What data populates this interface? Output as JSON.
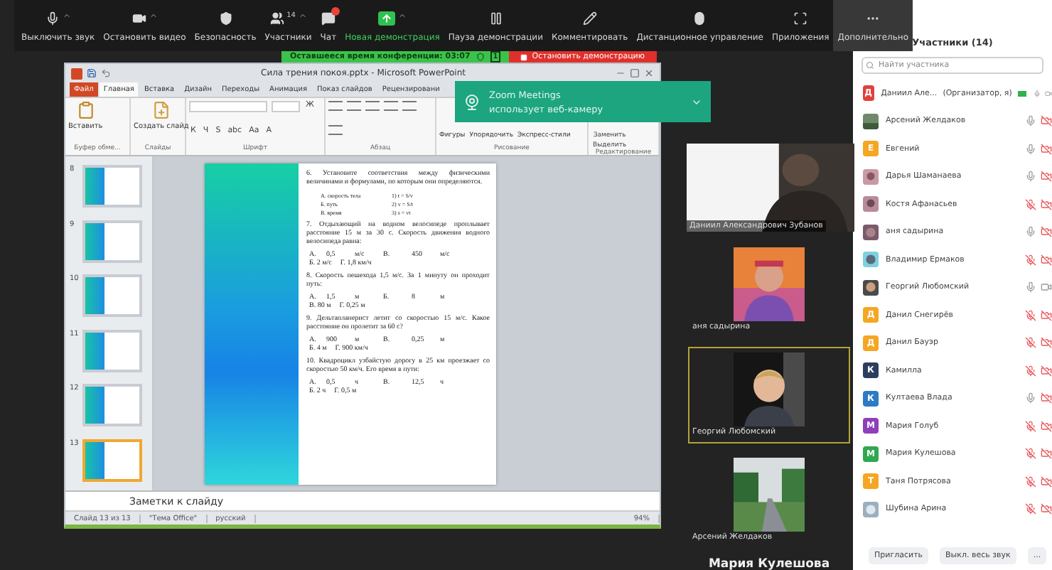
{
  "toolbar": {
    "items": [
      {
        "kind": "mic",
        "label": "Выключить звук",
        "caret": true
      },
      {
        "kind": "video",
        "label": "Остановить видео",
        "caret": true
      },
      {
        "kind": "security",
        "label": "Безопасность",
        "caret": false
      },
      {
        "kind": "participants",
        "label": "Участники",
        "caret": true,
        "count": "14"
      },
      {
        "kind": "chat",
        "label": "Чат",
        "caret": false
      },
      {
        "kind": "share",
        "label": "Новая демонстрация",
        "caret": true
      },
      {
        "kind": "pause",
        "label": "Пауза демонстрации",
        "caret": false
      },
      {
        "kind": "annotate",
        "label": "Комментировать",
        "caret": false
      },
      {
        "kind": "remote",
        "label": "Дистанционное управление",
        "caret": false
      },
      {
        "kind": "apps",
        "label": "Приложения",
        "caret": false
      },
      {
        "kind": "more",
        "label": "Дополнительно",
        "caret": false
      }
    ]
  },
  "meeting_bar": {
    "timer": "Оставшееся время конференции: 03:07",
    "counter": "1",
    "stop": "Остановить демонстрацию"
  },
  "powerpoint": {
    "title": "Сила трения покоя.pptx - Microsoft PowerPoint",
    "tabs": [
      {
        "label": "Файл",
        "selected": false,
        "kind": "file"
      },
      {
        "label": "Главная",
        "selected": true,
        "kind": "tab"
      },
      {
        "label": "Вставка",
        "selected": false,
        "kind": "tab"
      },
      {
        "label": "Дизайн",
        "selected": false,
        "kind": "tab"
      },
      {
        "label": "Переходы",
        "selected": false,
        "kind": "tab"
      },
      {
        "label": "Анимация",
        "selected": false,
        "kind": "tab"
      },
      {
        "label": "Показ слайдов",
        "selected": false,
        "kind": "tab"
      },
      {
        "label": "Рецензировани",
        "selected": false,
        "kind": "tab"
      }
    ],
    "ribbon": [
      {
        "kind": "clipboard",
        "label": "Буфер обме...",
        "buttons": [
          "Вставить"
        ]
      },
      {
        "kind": "slides",
        "label": "Слайды",
        "buttons": [
          "Создать слайд"
        ]
      },
      {
        "kind": "font",
        "label": "Шрифт",
        "buttons": [
          "Ж",
          "К",
          "Ч",
          "S",
          "abc",
          "Aa",
          "A"
        ]
      },
      {
        "kind": "paragraph",
        "label": "Абзац"
      },
      {
        "kind": "drawing",
        "label": "Рисование",
        "buttons": [
          "Фигуры",
          "Упорядочить",
          "Экспресс-стили"
        ]
      },
      {
        "kind": "editing",
        "label": "Редактирование",
        "buttons": [
          "Заменить",
          "Выделить"
        ]
      }
    ],
    "thumbnails": [
      {
        "number": "8",
        "selected": false
      },
      {
        "number": "9",
        "selected": false
      },
      {
        "number": "10",
        "selected": false
      },
      {
        "number": "11",
        "selected": false
      },
      {
        "number": "12",
        "selected": false
      },
      {
        "number": "13",
        "selected": true
      }
    ],
    "slide": [
      {
        "kind": "question",
        "text": "6. Установите соответствия между физическими величинами и формулами, по которым они определяются."
      },
      {
        "kind": "matching",
        "rows": [
          [
            "А. скорость тела",
            "1) t = S/v"
          ],
          [
            "Б. путь",
            "2) v = S/t"
          ],
          [
            "В. время",
            "3) s = vt"
          ]
        ]
      },
      {
        "kind": "question",
        "text": "7. Отдыхающий на водном велосипеде проплывает расстояние 15 м за 30 с. Скорость движения водного велосипеда равна:"
      },
      {
        "kind": "answers",
        "grid": [
          "А.",
          "0,5",
          "м/с",
          "В.",
          "450",
          "м/с"
        ],
        "line": [
          "Б. 2 м/с",
          "Г. 1,8 км/ч"
        ]
      },
      {
        "kind": "question",
        "text": "8. Скорость пешехода 1,5 м/с. За 1 минуту он проходит путь:"
      },
      {
        "kind": "answers",
        "grid": [
          "А.",
          "1,5",
          "м",
          "Б.",
          "8",
          "м"
        ],
        "line": [
          "В. 80 м",
          "Г. 0,25 м"
        ]
      },
      {
        "kind": "question",
        "text": "9. Дельтапланерист летит со скоростью 15 м/с. Какое расстояние он пролетит за 60 с?"
      },
      {
        "kind": "answers",
        "grid": [
          "А.",
          "900",
          "м",
          "В.",
          "0,25",
          "м"
        ],
        "line": [
          "Б. 4 м",
          "Г. 900 км/ч"
        ]
      },
      {
        "kind": "question",
        "text": "10. Квадроцикл узбайстую дорогу в 25 км проезжает со скоростью 50 км/ч. Его время в пути:"
      },
      {
        "kind": "answers",
        "grid": [
          "А.",
          "0,5",
          "ч",
          "В.",
          "12,5",
          "ч"
        ],
        "line": [
          "Б. 2 ч",
          "Г. 0,5 м"
        ]
      }
    ],
    "notes": "Заметки к слайду",
    "status": {
      "slide": "Слайд 13 из 13",
      "theme": "\"Тема Office\"",
      "language": "русский",
      "zoom": "94%"
    }
  },
  "notification": {
    "title": "Zoom Meetings",
    "text": "использует веб-камеру"
  },
  "videos": [
    {
      "name": "Даниил Александрович Зубанов",
      "highlighted": false
    },
    {
      "name": "аня садырина",
      "highlighted": false
    },
    {
      "name": "Георгий Любомский",
      "highlighted": true
    },
    {
      "name": "Арсений Желдаков",
      "highlighted": false
    }
  ],
  "active_speaker": "Мария Кулешова",
  "participants": {
    "title": "Участники (14)",
    "search_placeholder": "Найти участника",
    "rows": [
      {
        "name": "Даниил Але...",
        "role": "(Организатор, я)",
        "avatar": {
          "kind": "letter",
          "letter": "Д",
          "color": "#e0413b"
        },
        "mic_muted": false,
        "video_off": false
      },
      {
        "name": "Арсений Желдаков",
        "mic_muted": false,
        "video_off": true
      },
      {
        "name": "Евгений",
        "avatar": {
          "kind": "letter",
          "letter": "Е",
          "color": "#f5a623"
        },
        "mic_muted": false,
        "video_off": true
      },
      {
        "name": "Дарья Шаманаева",
        "mic_muted": false,
        "video_off": true
      },
      {
        "name": "Костя Афанасьев",
        "mic_muted": true,
        "video_off": true
      },
      {
        "name": "аня садырина",
        "mic_muted": false,
        "video_off": true
      },
      {
        "name": "Владимир Ермаков",
        "mic_muted": true,
        "video_off": true
      },
      {
        "name": "Георгий Любомский",
        "mic_muted": false,
        "video_off": false
      },
      {
        "name": "Данил Снегирёв",
        "avatar": {
          "kind": "letter",
          "letter": "Д",
          "color": "#f5a623"
        },
        "mic_muted": true,
        "video_off": true
      },
      {
        "name": "Данил Бауэр",
        "avatar": {
          "kind": "letter",
          "letter": "Д",
          "color": "#f5a623"
        },
        "mic_muted": true,
        "video_off": true
      },
      {
        "name": "Камилла",
        "avatar": {
          "kind": "letter",
          "letter": "К",
          "color": "#2c3e5e"
        },
        "mic_muted": true,
        "video_off": true
      },
      {
        "name": "Култаева Влада",
        "avatar": {
          "kind": "letter",
          "letter": "К",
          "color": "#2b7cc4"
        },
        "mic_muted": false,
        "video_off": true
      },
      {
        "name": "Мария Голуб",
        "avatar": {
          "kind": "letter",
          "letter": "М",
          "color": "#8e3fba"
        },
        "mic_muted": true,
        "video_off": true
      },
      {
        "name": "Мария Кулешова",
        "avatar": {
          "kind": "letter",
          "letter": "М",
          "color": "#2fa84f"
        },
        "mic_muted": true,
        "video_off": true
      },
      {
        "name": "Таня Потрясова",
        "avatar": {
          "kind": "letter",
          "letter": "Т",
          "color": "#f5a623"
        },
        "mic_muted": true,
        "video_off": true
      },
      {
        "name": "Шубина Арина",
        "mic_muted": true,
        "video_off": true
      }
    ],
    "buttons": [
      "Пригласить",
      "Выкл. весь звук",
      "..."
    ]
  }
}
